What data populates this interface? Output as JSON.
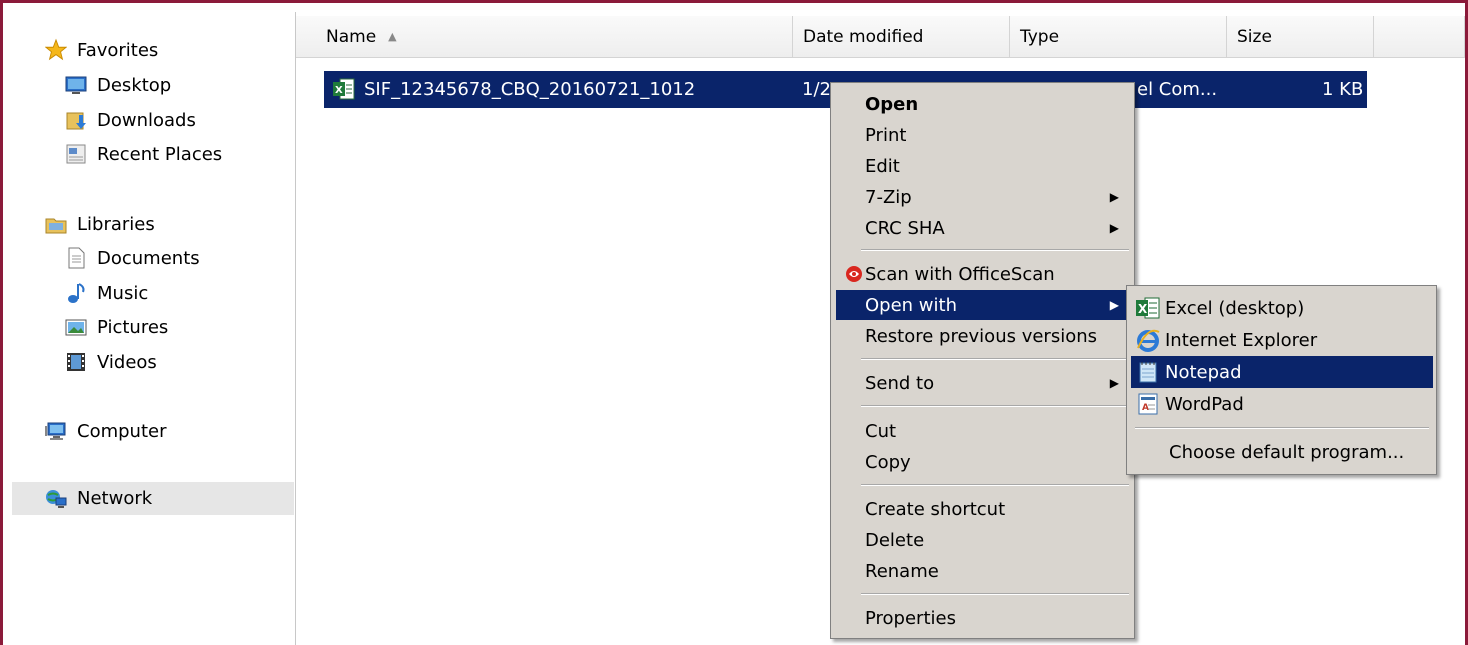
{
  "nav": {
    "favorites": "Favorites",
    "desktop": "Desktop",
    "downloads": "Downloads",
    "recent": "Recent Places",
    "libraries": "Libraries",
    "documents": "Documents",
    "music": "Music",
    "pictures": "Pictures",
    "videos": "Videos",
    "computer": "Computer",
    "network": "Network"
  },
  "columns": {
    "name": "Name",
    "date": "Date modified",
    "type": "Type",
    "size": "Size"
  },
  "file": {
    "name": "SIF_12345678_CBQ_20160721_1012",
    "date_partial": "1/2",
    "type_partial": "el Com...",
    "size": "1 KB"
  },
  "context_menu": {
    "open": "Open",
    "print": "Print",
    "edit": "Edit",
    "zip": "7-Zip",
    "crc": "CRC SHA",
    "scan": "Scan with OfficeScan",
    "open_with": "Open with",
    "restore": "Restore previous versions",
    "send_to": "Send to",
    "cut": "Cut",
    "copy": "Copy",
    "shortcut": "Create shortcut",
    "delete": "Delete",
    "rename": "Rename",
    "properties": "Properties"
  },
  "submenu": {
    "excel": "Excel (desktop)",
    "ie": "Internet Explorer",
    "notepad": "Notepad",
    "wordpad": "WordPad",
    "choose": "Choose default program..."
  },
  "colors": {
    "selection": "#0a246a",
    "menu_bg": "#d9d5cf",
    "frame": "#8b1a3a"
  }
}
